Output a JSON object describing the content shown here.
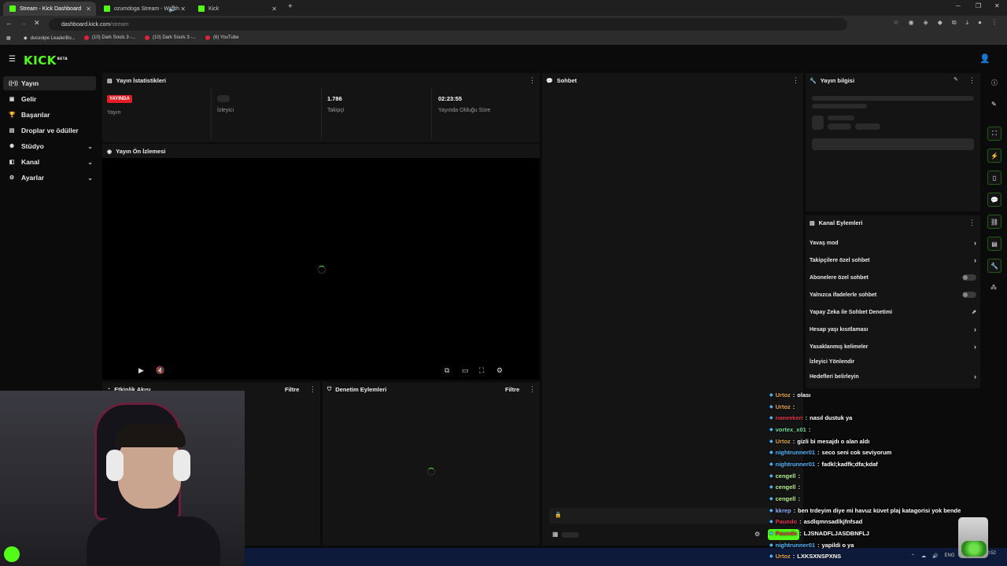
{
  "browser": {
    "tabs": [
      {
        "title": "Stream - Kick Dashboard",
        "active": true
      },
      {
        "title": "ozumdoga Stream - Watch",
        "active": false
      },
      {
        "title": "Kick",
        "active": false
      }
    ],
    "url_host": "dashboard.kick.com",
    "url_path": "/stream",
    "bookmarks": [
      "duceolpe LeaderBo...",
      "(10) Dark Souls 3 -...",
      "(10) Dark Souls 3 -...",
      "(6) YouTube"
    ]
  },
  "app": {
    "logo": "KICK",
    "logo_tag": "BETA",
    "accent": "#53fc18"
  },
  "sidebar": {
    "items": [
      {
        "label": "Yayın",
        "icon": "broadcast-icon"
      },
      {
        "label": "Gelir",
        "icon": "wallet-icon"
      },
      {
        "label": "Başarılar",
        "icon": "trophy-icon"
      },
      {
        "label": "Droplar ve ödüller",
        "icon": "gift-icon"
      },
      {
        "label": "Stüdyo",
        "icon": "studio-icon"
      },
      {
        "label": "Kanal",
        "icon": "channel-icon"
      },
      {
        "label": "Ayarlar",
        "icon": "gear-icon"
      }
    ]
  },
  "stats": {
    "title": "Yayın İstatistikleri",
    "live_badge": "YAYINDA",
    "live_label": "Yayın",
    "viewers_label": "İzleyici",
    "followers_value": "1.786",
    "followers_label": "Takipçi",
    "uptime_value": "02:23:55",
    "uptime_label": "Yayında Olduğu Süre"
  },
  "preview": {
    "title": "Yayın Ön İzlemesi"
  },
  "activity": {
    "title": "Etkinlik Akışı",
    "filter": "Filtre"
  },
  "moderation": {
    "title": "Denetim Eylemleri",
    "filter": "Filtre"
  },
  "chat": {
    "title": "Sohbet"
  },
  "info": {
    "title": "Yayın bilgisi"
  },
  "channel_actions": {
    "title": "Kanal Eylemleri",
    "items": [
      "Yavaş mod",
      "Takipçilere özel sohbet",
      "Abonelere özel sohbet",
      "Yalnızca ifadelerle sohbet",
      "Yapay Zeka ile Sohbet Denetimi",
      "Hesap yaşı kısıtlaması",
      "Yasaklanmış kelimeler",
      "İzleyici Yönlendir",
      "Hedefleri belirleyin"
    ]
  },
  "chat_overlay": [
    {
      "user": "Urtoz",
      "text": "olası",
      "color": "#e3a64a"
    },
    {
      "user": "Urtoz",
      "text": "",
      "color": "#e3a64a"
    },
    {
      "user": "naneekeri",
      "text": "nasıl dustuk ya",
      "color": "#e0364a"
    },
    {
      "user": "vortex_x01",
      "text": "",
      "color": "#6fdc9a"
    },
    {
      "user": "Urtoz",
      "text": "gizli bi mesajdı o alan aldı",
      "color": "#e3a64a"
    },
    {
      "user": "nightrunner01",
      "text": "seco seni cok seviyorum",
      "color": "#4ab7ff"
    },
    {
      "user": "nightrunner01",
      "text": "fadkl;kadfk;dfa;kdaf",
      "color": "#4ab7ff"
    },
    {
      "user": "cengell",
      "text": "",
      "color": "#b8f08a"
    },
    {
      "user": "cengell",
      "text": "",
      "color": "#b8f08a"
    },
    {
      "user": "cengell",
      "text": "",
      "color": "#b8f08a"
    },
    {
      "user": "kkrep",
      "text": "ben trdeyim diye mi havuz küvet plaj katagorisi yok bende",
      "color": "#8fb0ff"
    },
    {
      "user": "Paundo",
      "text": "asdlqmnsadlkjfnfsad",
      "color": "#e0364a"
    },
    {
      "user": "Paundo",
      "text": "LJSNADFLJASDBNFLJ",
      "color": "#e0364a"
    },
    {
      "user": "nightrunner01",
      "text": "yapildi o ya",
      "color": "#4ab7ff"
    },
    {
      "user": "Urtoz",
      "text": "LXKSXNSPXNS",
      "color": "#e3a64a"
    }
  ],
  "taskbar": {
    "lang": "ENG",
    "time": "20:52"
  }
}
